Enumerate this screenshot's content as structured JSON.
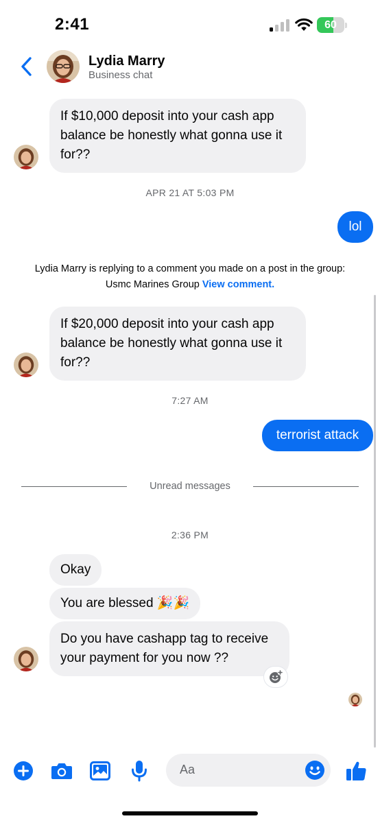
{
  "status_bar": {
    "time": "2:41",
    "battery_percent": "60",
    "battery_level": 0.6
  },
  "header": {
    "contact_name": "Lydia Marry",
    "subtitle": "Business chat"
  },
  "messages": {
    "m1_lines": [
      "If $10,000 deposit into your cash app",
      "balance be honestly what gonna use it",
      "for??"
    ],
    "ts1": "APR 21 AT 5:03 PM",
    "m2": "lol",
    "note_line1": "Lydia Marry is replying to a comment you made on a post in the group:",
    "note_group": "Usmc Marines Group",
    "note_link": "View comment.",
    "m3_lines": [
      "If $20,000 deposit into your cash app",
      "balance be honestly what gonna use it",
      "for??"
    ],
    "ts2": "7:27 AM",
    "m4": "terrorist attack",
    "unread_label": "Unread messages",
    "ts3": "2:36 PM",
    "m5": "Okay",
    "m6": "You are blessed 🎉🎉",
    "m7_lines": [
      "Do you have cashapp tag to receive",
      "your payment for you now ??"
    ]
  },
  "composer": {
    "placeholder": "Aa"
  },
  "colors": {
    "accent": "#0a6ef2",
    "incoming_bubble": "#f0f0f2",
    "secondary_text": "#65676b"
  },
  "icons": [
    "back-chevron-icon",
    "plus-icon",
    "camera-icon",
    "image-icon",
    "microphone-icon",
    "emoji-icon",
    "thumbs-up-icon",
    "add-reaction-icon"
  ]
}
